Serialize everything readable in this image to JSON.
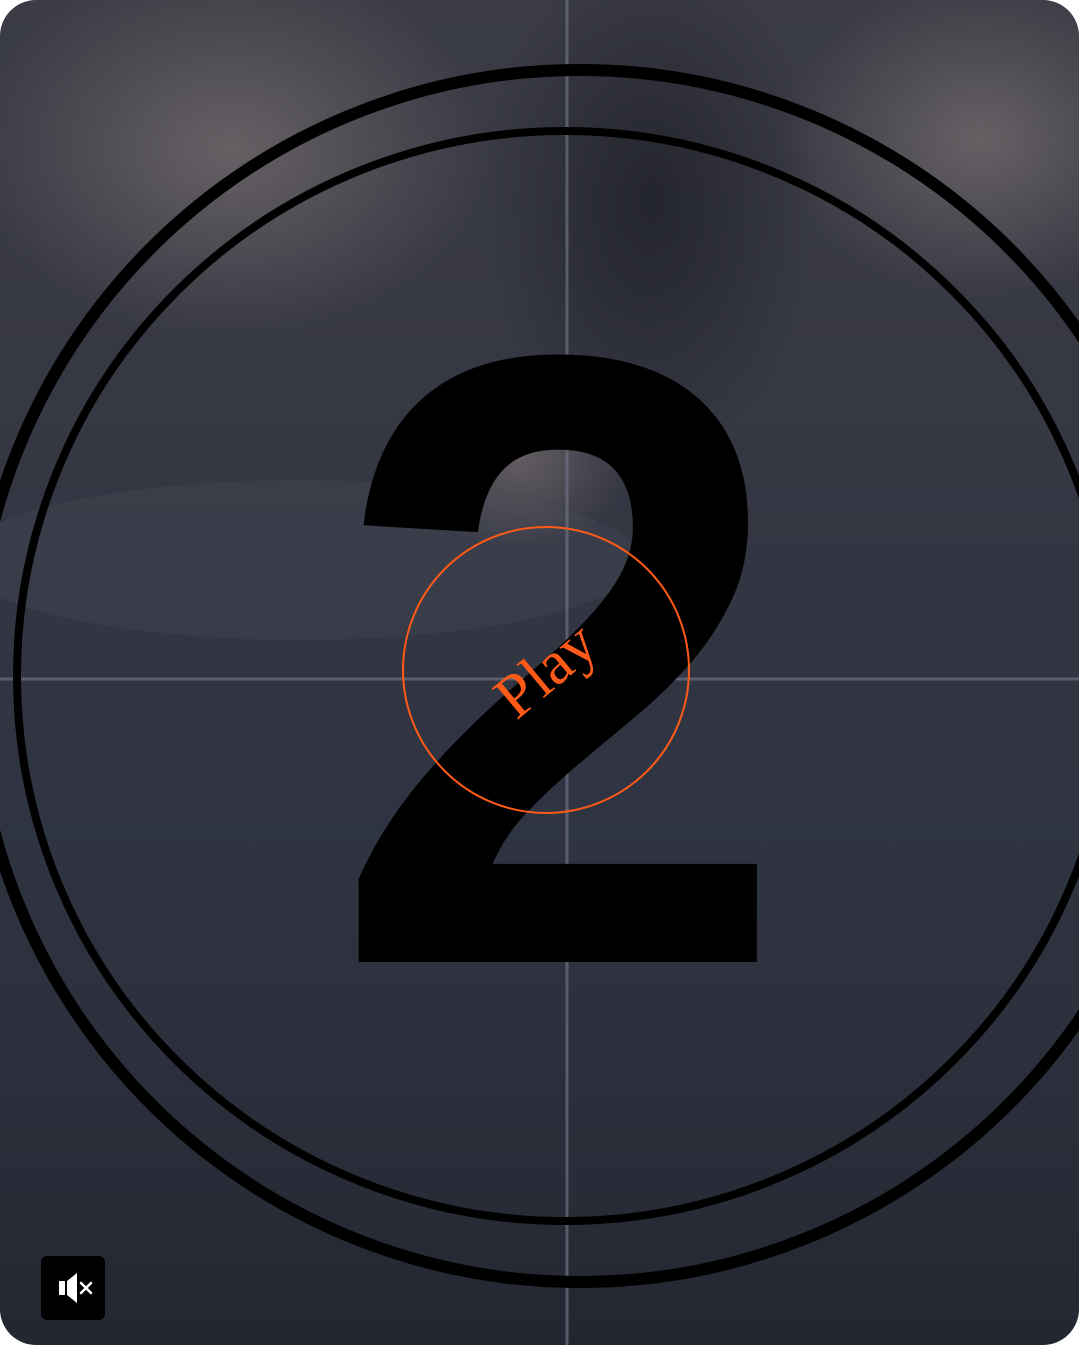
{
  "player": {
    "countdown_number": "2",
    "play_label": "Play",
    "accent_color": "#ff5a17",
    "mute_icon": "speaker-muted-icon",
    "muted": true
  }
}
